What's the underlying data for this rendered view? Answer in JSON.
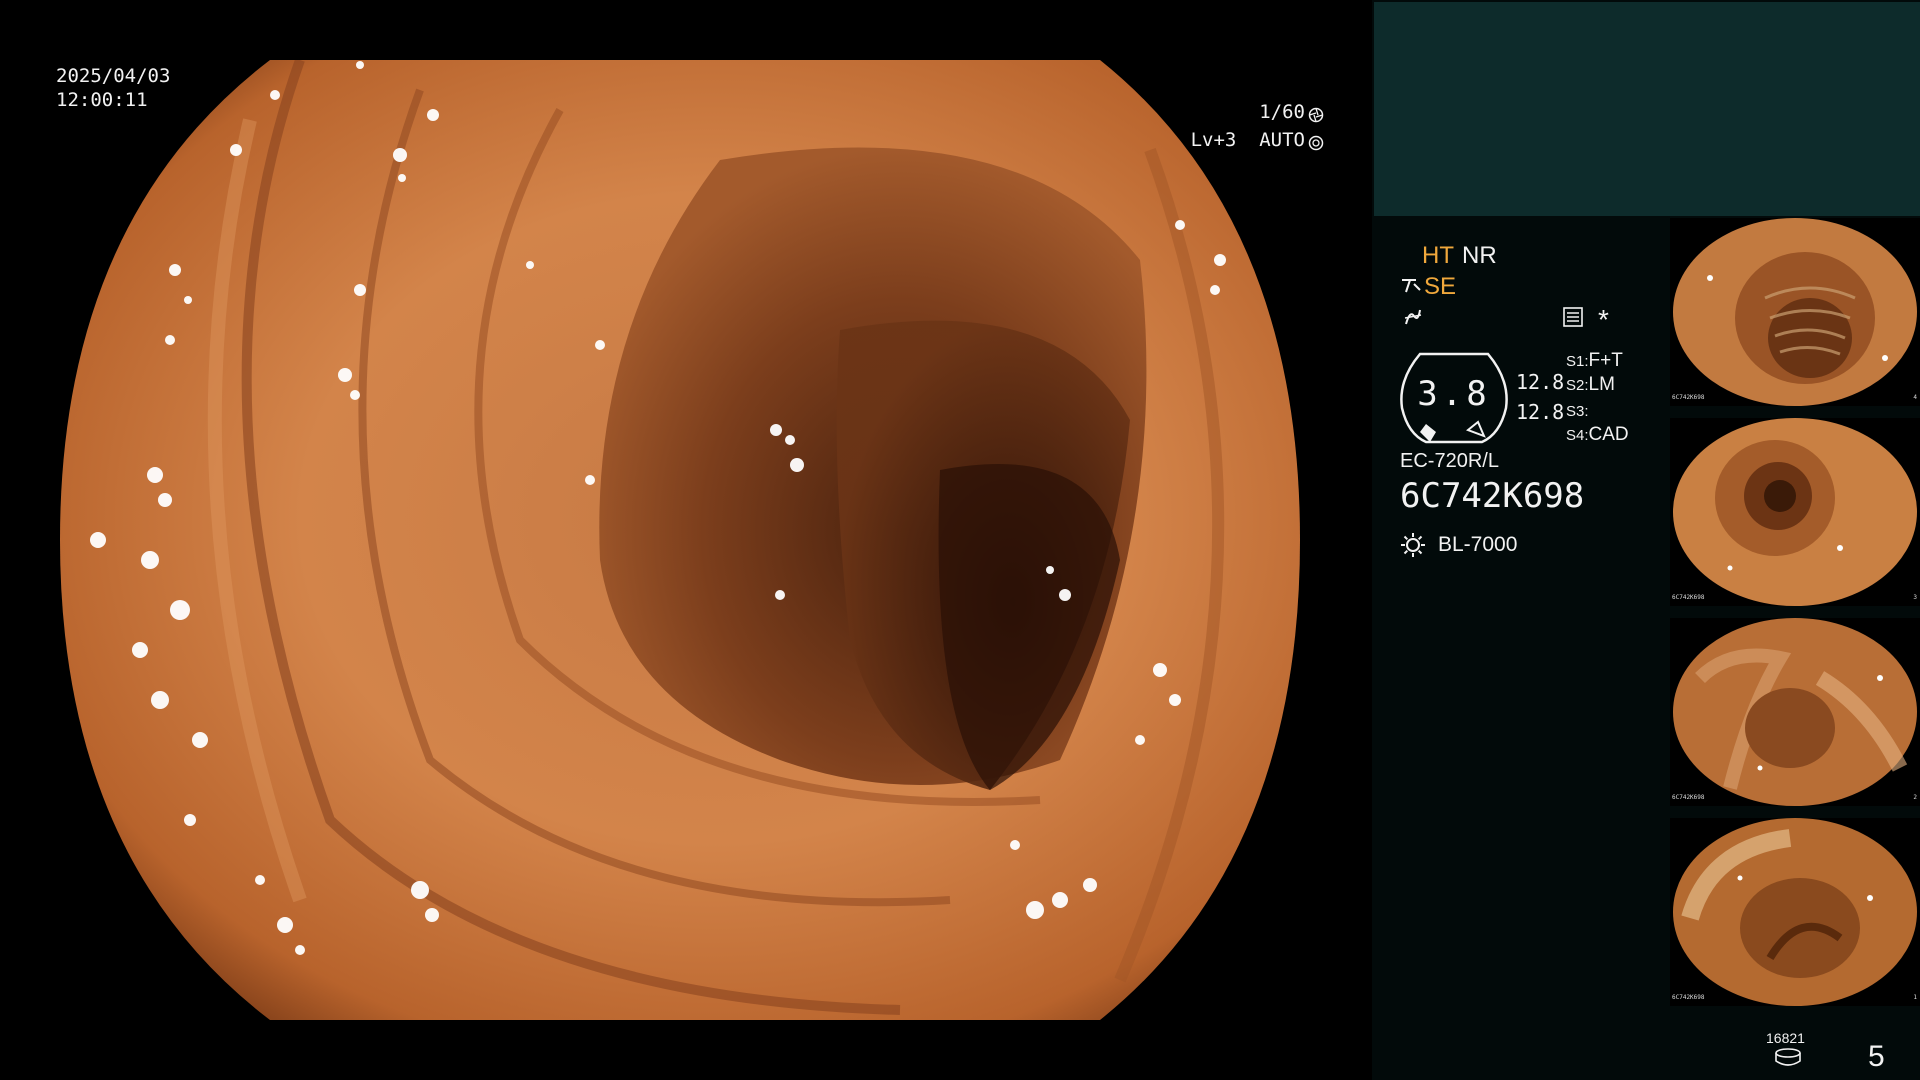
{
  "overlay": {
    "date": "2025/04/03",
    "time": "12:00:11",
    "shutter": "1/60",
    "exposure": "Lv+3  AUTO"
  },
  "panel": {
    "ht_label": "HT",
    "nr_label": "NR",
    "se_label": "SE",
    "asterisk": "*",
    "gauge_value": "3.8",
    "gauge_top_value": "12.8",
    "gauge_bottom_value": "12.8",
    "switches": [
      {
        "key": "S1:",
        "value": "F+T"
      },
      {
        "key": "S2:",
        "value": "LM"
      },
      {
        "key": "S3:",
        "value": ""
      },
      {
        "key": "S4:",
        "value": "CAD"
      }
    ],
    "scope_model": "EC-720R/L",
    "scope_serial": "6C742K698",
    "light_source": "BL-7000",
    "frame_count": "16821",
    "image_number": "5"
  },
  "thumbnails": [
    {
      "serial": "6C742K698",
      "index": "4"
    },
    {
      "serial": "6C742K698",
      "index": "3"
    },
    {
      "serial": "6C742K698",
      "index": "2"
    },
    {
      "serial": "6C742K698",
      "index": "1"
    }
  ],
  "colors": {
    "panel_bg": "#020a0a",
    "panel_top": "#0d2b2b",
    "accent_orange": "#f0a83c",
    "tissue": "#c8763e"
  },
  "icons": {
    "shutter": "aperture-icon",
    "auto": "exposure-icon",
    "se": "scope-tip-icon",
    "wave": "wave-icon",
    "record": "record-icon",
    "light": "sun-icon",
    "storage": "database-icon"
  }
}
